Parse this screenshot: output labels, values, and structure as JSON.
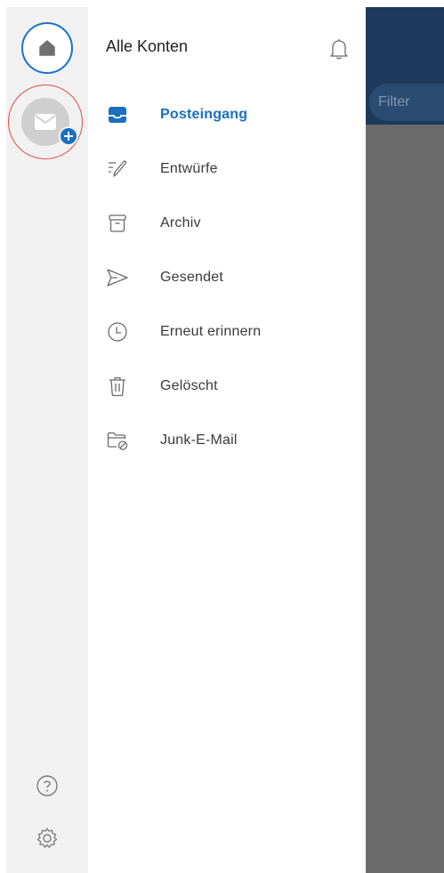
{
  "background_app": {
    "filter_label": "Filter"
  },
  "rail": {
    "home_icon": "home-icon",
    "add_account_icon": "mail-add-icon",
    "help_icon": "help-icon",
    "settings_icon": "gear-icon"
  },
  "drawer": {
    "title": "Alle Konten",
    "notification_icon": "bell-icon",
    "folders": [
      {
        "label": "Posteingang",
        "icon": "inbox-icon",
        "active": true
      },
      {
        "label": "Entwürfe",
        "icon": "draft-pencil-icon",
        "active": false
      },
      {
        "label": "Archiv",
        "icon": "archive-icon",
        "active": false
      },
      {
        "label": "Gesendet",
        "icon": "send-icon",
        "active": false
      },
      {
        "label": "Erneut erinnern",
        "icon": "clock-icon",
        "active": false
      },
      {
        "label": "Gelöscht",
        "icon": "trash-icon",
        "active": false
      },
      {
        "label": "Junk-E-Mail",
        "icon": "junk-folder-icon",
        "active": false
      }
    ]
  },
  "colors": {
    "accent": "#1a6fc1",
    "rail_background": "#f1f1f1",
    "highlight_ring": "#e04b4b",
    "header_dark": "#1d3a5c",
    "overlay": "#6b6b6b"
  }
}
